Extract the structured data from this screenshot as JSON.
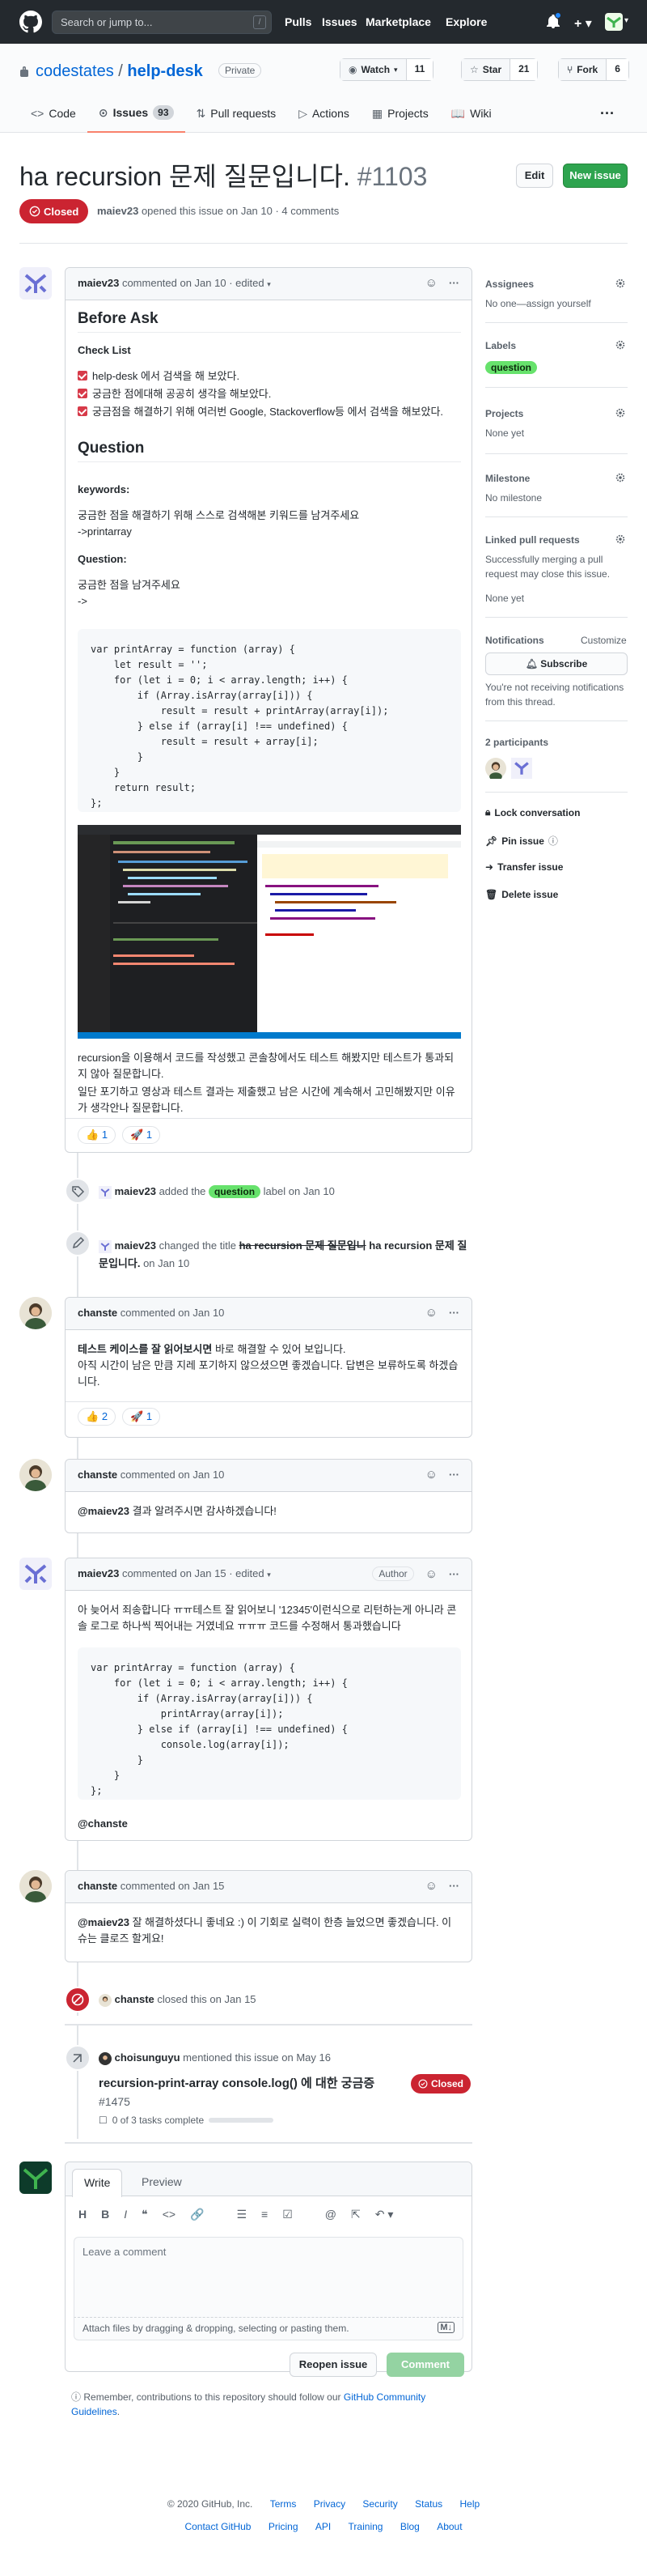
{
  "header": {
    "search_placeholder": "Search or jump to...",
    "slash_key": "/",
    "nav": [
      "Pulls",
      "Issues",
      "Marketplace",
      "Explore"
    ]
  },
  "repo": {
    "owner": "codestates",
    "separator": "/",
    "name": "help-desk",
    "visibility": "Private",
    "watch_label": "Watch",
    "watch_count": "11",
    "star_label": "Star",
    "star_count": "21",
    "fork_label": "Fork",
    "fork_count": "6",
    "tabs": [
      {
        "label": "Code"
      },
      {
        "label": "Issues",
        "count": "93"
      },
      {
        "label": "Pull requests"
      },
      {
        "label": "Actions"
      },
      {
        "label": "Projects"
      },
      {
        "label": "Wiki"
      }
    ]
  },
  "issue": {
    "title": "ha recursion 문제 질문입니다.",
    "number": "#1103",
    "state": "Closed",
    "author": "maiev23",
    "opened_text": "opened this issue on Jan 10 · 4 comments",
    "edit_label": "Edit",
    "new_issue_label": "New issue"
  },
  "first_comment": {
    "author": "maiev23",
    "meta": "commented on Jan 10 · edited",
    "h_before": "Before Ask",
    "checklist_title": "Check List",
    "checks": [
      "help-desk 에서 검색을 해 보았다.",
      "궁금한 점에대해 공공히 생각을 해보았다.",
      "궁금점을 해결하기 위해 여러번 Google, Stackoverflow등 에서 검색을 해보았다."
    ],
    "h_question": "Question",
    "keywords_label": "keywords:",
    "keywords_text1": "궁금한 점을 해결하기 위해 스스로 검색해본 키워드를 남겨주세요",
    "keywords_text2": "->printarray",
    "question_label": "Question:",
    "question_text1": "궁금한 점을 남겨주세요",
    "question_text2": "->",
    "code": "var printArray = function (array) {\n    let result = '';\n    for (let i = 0; i < array.length; i++) {\n        if (Array.isArray(array[i])) {\n            result = result + printArray(array[i]);\n        } else if (array[i] !== undefined) {\n            result = result + array[i];\n        }\n    }\n    return result;\n};",
    "body1": "recursion을 이용해서 코드를 작성했고 콘솔창에서도 테스트 해봤지만 테스트가 통과되지 않아 질문합니다.",
    "body2": "일단 포기하고 영상과 테스트 결과는 제출했고 남은 시간에 계속해서 고민해봤지만 이유가 생각안나 질문합니다.",
    "reactions": [
      {
        "emoji": "👍",
        "count": "1"
      },
      {
        "emoji": "🚀",
        "count": "1"
      }
    ]
  },
  "events": {
    "label_user": "maiev23",
    "label_action": "added the",
    "label_name": "question",
    "label_suffix": "label on Jan 10",
    "rename_user": "maiev23",
    "rename_action": "changed the title",
    "rename_old": "ha recursion 문제 질문입니",
    "rename_new": "ha recursion 문제 질문입니다.",
    "rename_date": "on Jan 10",
    "close_user": "chanste",
    "close_text": "closed this on Jan 15"
  },
  "comment2": {
    "author": "chanste",
    "meta": "commented on Jan 10",
    "bold": "테스트 케이스를 잘 읽어보시면",
    "text1": " 바로 해결할 수 있어 보입니다.",
    "text2": "아직 시간이 남은 만큼 지레 포기하지 않으셨으면 좋겠습니다. 답변은 보류하도록 하겠습니다.",
    "reactions": [
      {
        "emoji": "👍",
        "count": "2"
      },
      {
        "emoji": "🚀",
        "count": "1"
      }
    ]
  },
  "comment3": {
    "author": "chanste",
    "meta": "commented on Jan 10",
    "mention": "@maiev23",
    "text": " 결과 알려주시면 감사하겠습니다!"
  },
  "comment4": {
    "author": "maiev23",
    "meta": "commented on Jan 15 · edited",
    "author_badge": "Author",
    "text": "아 늦어서 죄송합니다 ㅠㅠ테스트 잘 읽어보니 '12345'이런식으로 리턴하는게 아니라 콘솔 로그로 하나씩 찍어내는 거였네요 ㅠㅠㅠ 코드를 수정해서 통과했습니다",
    "code": "var printArray = function (array) {\n    for (let i = 0; i < array.length; i++) {\n        if (Array.isArray(array[i])) {\n            printArray(array[i]);\n        } else if (array[i] !== undefined) {\n            console.log(array[i]);\n        }\n    }\n};",
    "mention": "@chanste"
  },
  "comment5": {
    "author": "chanste",
    "meta": "commented on Jan 15",
    "mention": "@maiev23",
    "text": " 잘 해결하셨다니 좋네요 :) 이 기회로 실력이 한층 늘었으면 좋겠습니다. 이슈는 클로즈 할게요!"
  },
  "mention_event": {
    "user": "choisunguyu",
    "text": "mentioned this issue on May 16",
    "ref_title": "recursion-print-array console.log() 에 대한 궁금증",
    "ref_number": "#1475",
    "ref_state": "Closed",
    "tasks": "0 of 3 tasks complete"
  },
  "editor": {
    "tab_write": "Write",
    "tab_preview": "Preview",
    "placeholder": "Leave a comment",
    "attach_hint": "Attach files by dragging & dropping, selecting or pasting them.",
    "reopen_label": "Reopen issue",
    "comment_label": "Comment",
    "guideline_prefix": "Remember, contributions to this repository should follow our",
    "guideline_link": "GitHub Community Guidelines",
    "guideline_suffix": "."
  },
  "sidebar": {
    "assignees_h": "Assignees",
    "assignees_v": "No one—assign yourself",
    "labels_h": "Labels",
    "labels_v": "question",
    "projects_h": "Projects",
    "projects_v": "None yet",
    "milestone_h": "Milestone",
    "milestone_v": "No milestone",
    "linked_h": "Linked pull requests",
    "linked_v1": "Successfully merging a pull",
    "linked_v2": "request may close this issue.",
    "linked_v3": "None yet",
    "notif_h": "Notifications",
    "notif_customize": "Customize",
    "subscribe_label": "Subscribe",
    "notif_v1": "You're not receiving notifications",
    "notif_v2": "from this thread.",
    "participants": "2 participants",
    "lock": "Lock conversation",
    "pin": "Pin issue",
    "transfer": "Transfer issue",
    "delete": "Delete issue"
  },
  "footer": {
    "copyright": "© 2020 GitHub, Inc.",
    "row1": [
      "Terms",
      "Privacy",
      "Security",
      "Status",
      "Help"
    ],
    "row2": [
      "Contact GitHub",
      "Pricing",
      "API",
      "Training",
      "Blog",
      "About"
    ]
  },
  "colors": {
    "header_bg": "#24292e",
    "closed_red": "#cb2431",
    "green": "#2ea44f",
    "link": "#0366d6",
    "label_question": "#67e26c"
  }
}
